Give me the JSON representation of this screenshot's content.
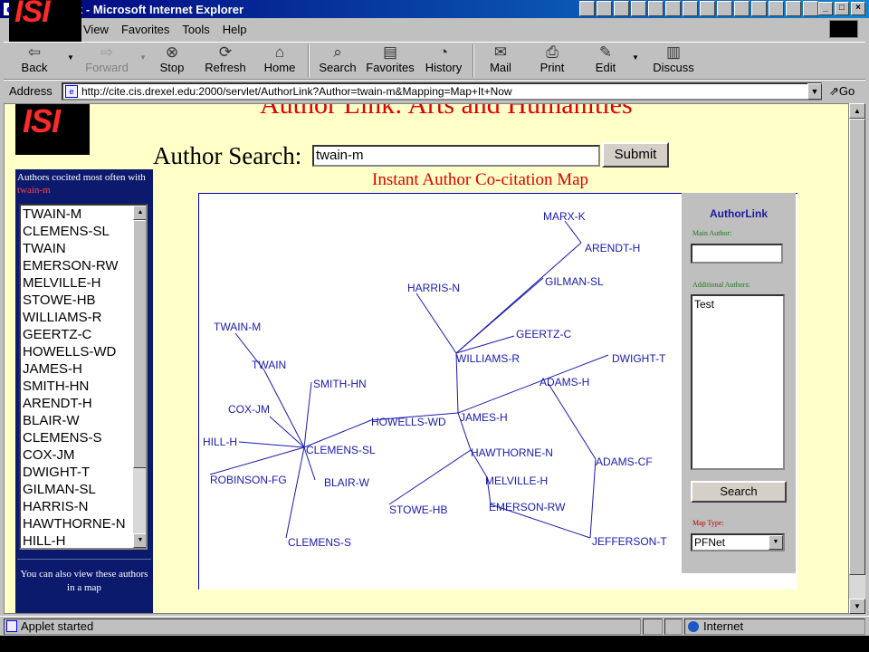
{
  "window": {
    "title": "AuthorLink - Microsoft Internet Explorer",
    "corner_logo": "ISI"
  },
  "menu": [
    "View",
    "Favorites",
    "Tools",
    "Help"
  ],
  "toolbar": [
    {
      "label": "Back",
      "icon": "back-arrow-icon"
    },
    {
      "label": "Forward",
      "icon": "forward-arrow-icon"
    },
    {
      "label": "Stop",
      "icon": "stop-icon"
    },
    {
      "label": "Refresh",
      "icon": "refresh-icon"
    },
    {
      "label": "Home",
      "icon": "home-icon"
    },
    {
      "label": "Search",
      "icon": "search-icon"
    },
    {
      "label": "Favorites",
      "icon": "favorites-icon"
    },
    {
      "label": "History",
      "icon": "history-icon"
    },
    {
      "label": "Mail",
      "icon": "mail-icon"
    },
    {
      "label": "Print",
      "icon": "print-icon"
    },
    {
      "label": "Edit",
      "icon": "edit-icon"
    },
    {
      "label": "Discuss",
      "icon": "discuss-icon"
    }
  ],
  "address": {
    "label": "Address",
    "url": "http://cite.cis.drexel.edu:2000/servlet/AuthorLink?Author=twain-m&Mapping=Map+It+Now",
    "go": "Go"
  },
  "page": {
    "logo": "ISI",
    "heading": "Author Link: Arts and Humanities",
    "search_label": "Author Search:",
    "search_value": "twain-m",
    "submit": "Submit",
    "map_title": "Instant Author Co-citation Map"
  },
  "left_panel": {
    "header": "Authors cocited most often with",
    "highlight": "twain-m",
    "authors": [
      "TWAIN-M",
      "CLEMENS-SL",
      "TWAIN",
      "EMERSON-RW",
      "MELVILLE-H",
      "STOWE-HB",
      "WILLIAMS-R",
      "GEERTZ-C",
      "HOWELLS-WD",
      "JAMES-H",
      "SMITH-HN",
      "ARENDT-H",
      "BLAIR-W",
      "CLEMENS-S",
      "COX-JM",
      "DWIGHT-T",
      "GILMAN-SL",
      "HARRIS-N",
      "HAWTHORNE-N",
      "HILL-H"
    ],
    "footer": "You can also view these authors in a map"
  },
  "applet": {
    "title": "AuthorLink",
    "main_author_label": "Main Author:",
    "main_author_value": "",
    "additional_label": "Additional Authors:",
    "additional_value": "Test",
    "search": "Search",
    "map_type_label": "Map Type:",
    "map_type_value": "PFNet"
  },
  "map": {
    "node_color": "#1a1ab0",
    "nodes": [
      {
        "id": "MARX-K",
        "label": "MARX-K"
      },
      {
        "id": "ARENDT-H",
        "label": "ARENDT-H"
      },
      {
        "id": "GILMAN-SL",
        "label": "GILMAN-SL"
      },
      {
        "id": "HARRIS-N",
        "label": "HARRIS-N"
      },
      {
        "id": "GEERTZ-C",
        "label": "GEERTZ-C"
      },
      {
        "id": "WILLIAMS-R",
        "label": "WILLIAMS-R"
      },
      {
        "id": "DWIGHT-T",
        "label": "DWIGHT-T"
      },
      {
        "id": "ADAMS-H",
        "label": "ADAMS-H"
      },
      {
        "id": "TWAIN-M",
        "label": "TWAIN-M"
      },
      {
        "id": "TWAIN",
        "label": "TWAIN"
      },
      {
        "id": "SMITH-HN",
        "label": "SMITH-HN"
      },
      {
        "id": "COX-JM",
        "label": "COX-JM"
      },
      {
        "id": "HOWELLS-WD",
        "label": "HOWELLS-WD"
      },
      {
        "id": "JAMES-H",
        "label": "JAMES-H"
      },
      {
        "id": "HILL-H",
        "label": "HILL-H"
      },
      {
        "id": "CLEMENS-SL",
        "label": "CLEMENS-SL"
      },
      {
        "id": "HAWTHORNE-N",
        "label": "HAWTHORNE-N"
      },
      {
        "id": "ADAMS-CF",
        "label": "ADAMS-CF"
      },
      {
        "id": "ROBINSON-FG",
        "label": "ROBINSON-FG"
      },
      {
        "id": "BLAIR-W",
        "label": "BLAIR-W"
      },
      {
        "id": "MELVILLE-H",
        "label": "MELVILLE-H"
      },
      {
        "id": "STOWE-HB",
        "label": "STOWE-HB"
      },
      {
        "id": "EMERSON-RW",
        "label": "EMERSON-RW"
      },
      {
        "id": "CLEMENS-S",
        "label": "CLEMENS-S"
      },
      {
        "id": "JEFFERSON-T",
        "label": "JEFFERSON-T"
      }
    ],
    "edges": [
      [
        "MARX-K",
        "ARENDT-H"
      ],
      [
        "ARENDT-H",
        "WILLIAMS-R"
      ],
      [
        "GILMAN-SL",
        "WILLIAMS-R"
      ],
      [
        "HARRIS-N",
        "WILLIAMS-R"
      ],
      [
        "GEERTZ-C",
        "WILLIAMS-R"
      ],
      [
        "WILLIAMS-R",
        "JAMES-H"
      ],
      [
        "JAMES-H",
        "DWIGHT-T"
      ],
      [
        "JAMES-H",
        "HOWELLS-WD"
      ],
      [
        "ADAMS-H",
        "ADAMS-CF"
      ],
      [
        "ADAMS-CF",
        "JEFFERSON-T"
      ],
      [
        "JAMES-H",
        "HAWTHORNE-N"
      ],
      [
        "HAWTHORNE-N",
        "STOWE-HB"
      ],
      [
        "HAWTHORNE-N",
        "MELVILLE-H"
      ],
      [
        "MELVILLE-H",
        "EMERSON-RW"
      ],
      [
        "EMERSON-RW",
        "JEFFERSON-T"
      ],
      [
        "HOWELLS-WD",
        "CLEMENS-SL"
      ],
      [
        "TWAIN-M",
        "TWAIN"
      ],
      [
        "TWAIN",
        "CLEMENS-SL"
      ],
      [
        "SMITH-HN",
        "CLEMENS-SL"
      ],
      [
        "COX-JM",
        "CLEMENS-SL"
      ],
      [
        "HILL-H",
        "CLEMENS-SL"
      ],
      [
        "ROBINSON-FG",
        "CLEMENS-SL"
      ],
      [
        "BLAIR-W",
        "CLEMENS-SL"
      ],
      [
        "CLEMENS-S",
        "CLEMENS-SL"
      ]
    ]
  },
  "status": {
    "text": "Applet started",
    "zone": "Internet"
  }
}
